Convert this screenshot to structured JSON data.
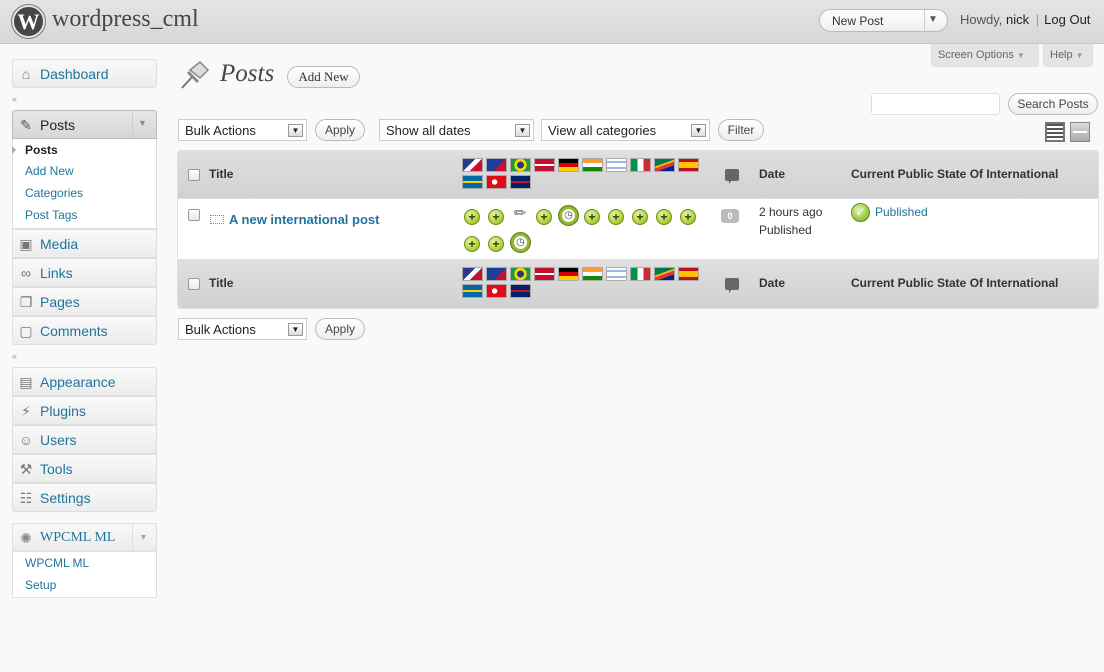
{
  "header": {
    "site_title": "wordpress_cml",
    "favorite_action": "New Post",
    "howdy_prefix": "Howdy,",
    "username": "nick",
    "separator": "|",
    "logout": "Log Out"
  },
  "screen_meta": {
    "screen_options": "Screen Options",
    "help": "Help"
  },
  "menu": {
    "dashboard": "Dashboard",
    "posts": "Posts",
    "posts_sub": [
      "Posts",
      "Add New",
      "Categories",
      "Post Tags"
    ],
    "media": "Media",
    "links": "Links",
    "pages": "Pages",
    "comments": "Comments",
    "appearance": "Appearance",
    "plugins": "Plugins",
    "users": "Users",
    "tools": "Tools",
    "settings": "Settings",
    "wpcml": "WPCML ML",
    "wpcml_sub": [
      "WPCML ML",
      "Setup"
    ]
  },
  "page": {
    "title": "Posts",
    "add_new": "Add New",
    "search_placeholder": "",
    "search_button": "Search Posts"
  },
  "filters": {
    "bulk_actions": "Bulk Actions",
    "apply": "Apply",
    "dates": "Show all dates",
    "categories": "View all categories",
    "filter": "Filter"
  },
  "table": {
    "col_title": "Title",
    "col_date": "Date",
    "col_state": "Current Public State Of International",
    "languages": [
      "us",
      "au",
      "br",
      "dk",
      "de",
      "in",
      "il",
      "it",
      "za",
      "es",
      "se",
      "tr",
      "gb"
    ],
    "rows": [
      {
        "title": "A new international post",
        "comments": "0",
        "date": "2 hours ago",
        "status": "Published",
        "state": "Published"
      }
    ]
  },
  "colors": {
    "link": "#21759b",
    "header_bg": "#d7d7d7",
    "page_bg": "#f9f9f9"
  }
}
